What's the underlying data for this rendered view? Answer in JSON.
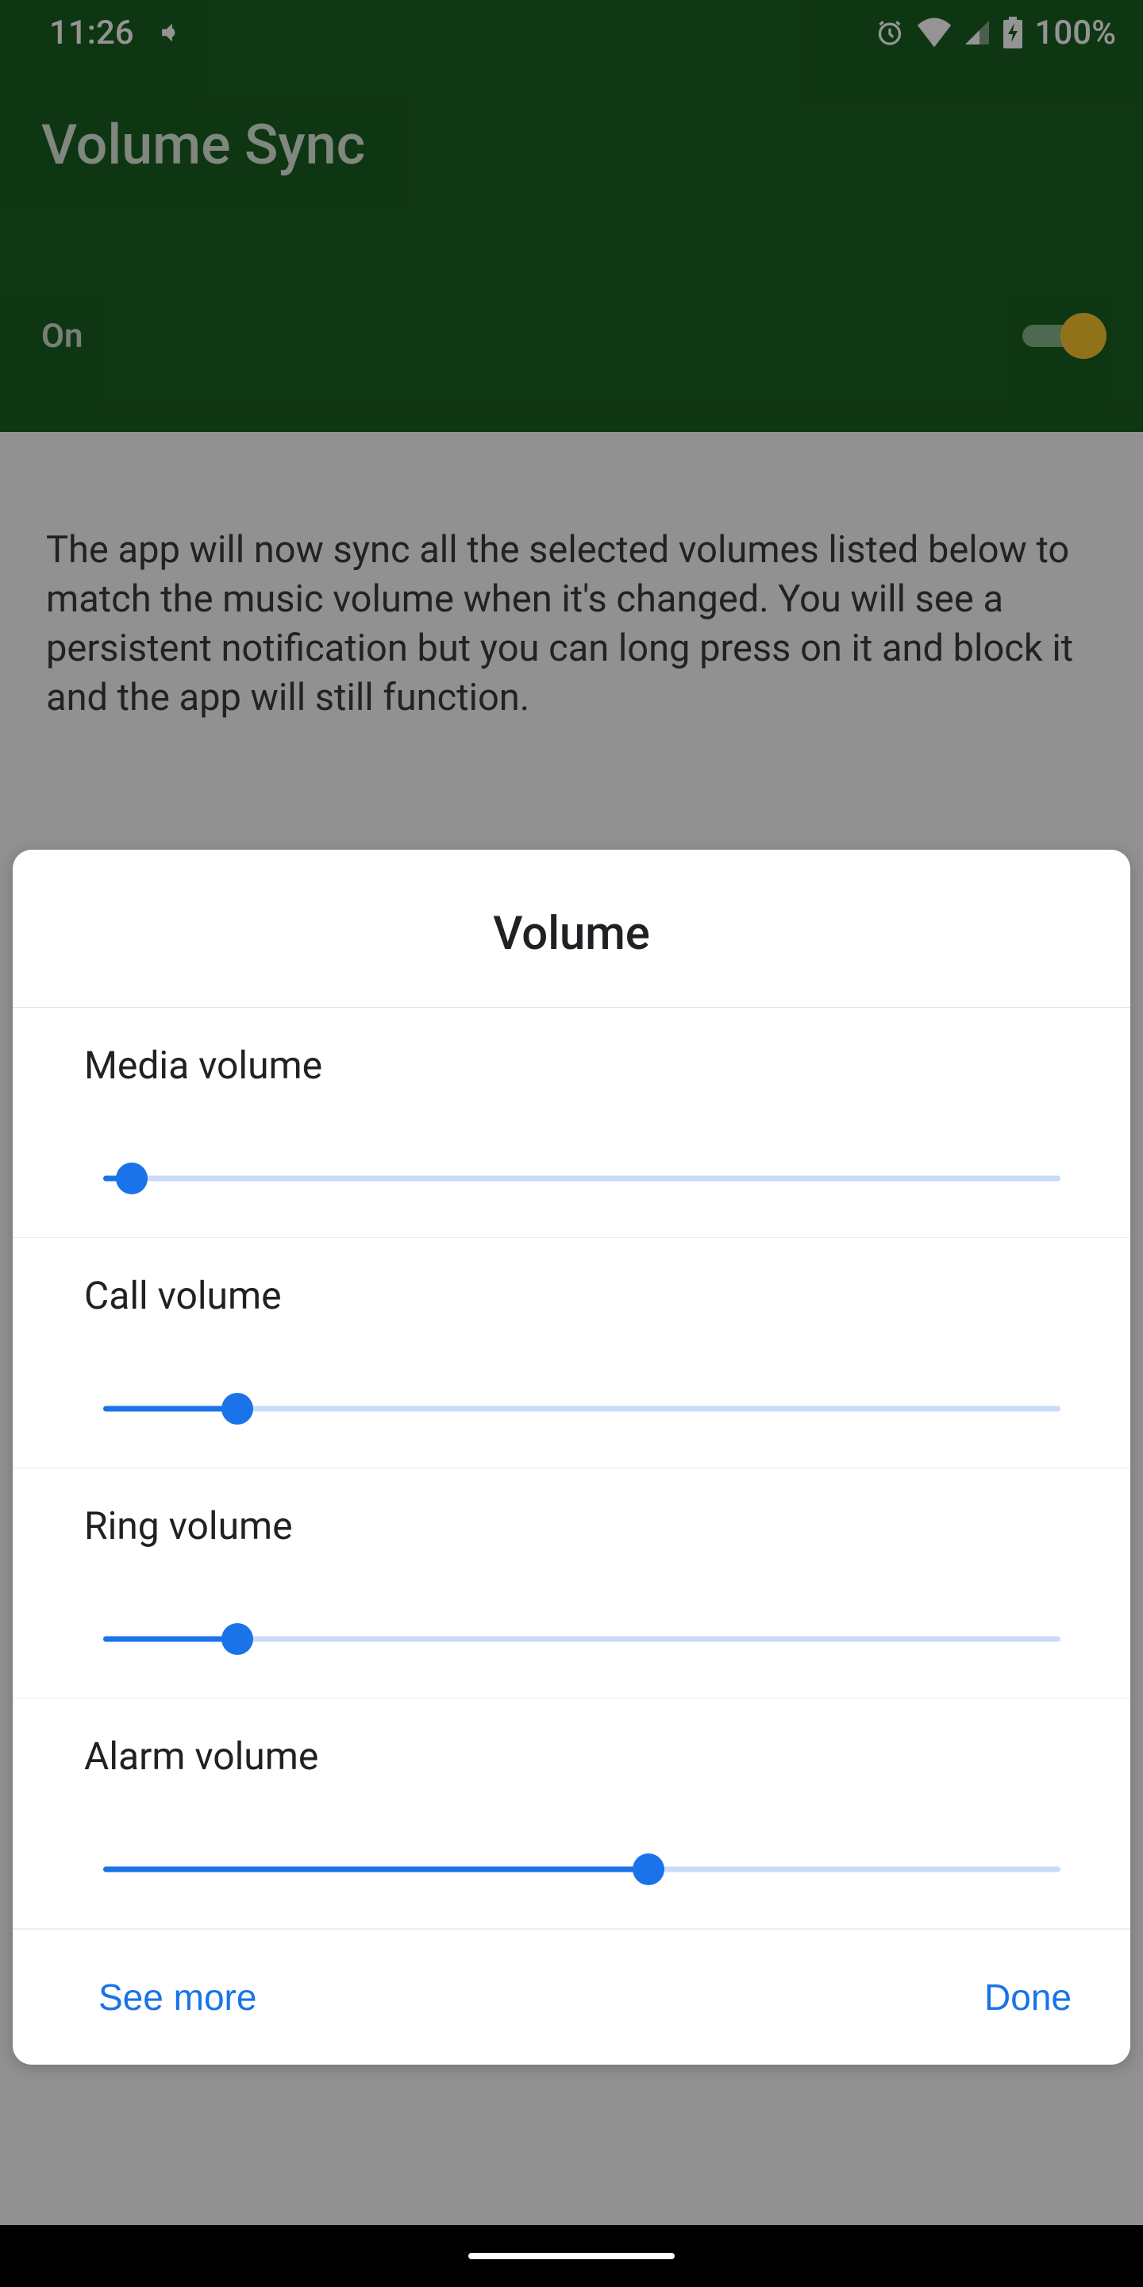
{
  "statusbar": {
    "time": "11:26",
    "battery_text": "100%"
  },
  "app": {
    "title": "Volume Sync",
    "on_label": "On",
    "on_state": true,
    "description": "The app will now sync all the selected volumes listed below to match the music volume when it's changed. You will see a persistent notification but you can long press on it and block it and the app will still function."
  },
  "dialog": {
    "title": "Volume",
    "sliders": [
      {
        "label": "Media volume",
        "value": 3
      },
      {
        "label": "Call volume",
        "value": 14
      },
      {
        "label": "Ring volume",
        "value": 14
      },
      {
        "label": "Alarm volume",
        "value": 57
      }
    ],
    "see_more": "See more",
    "done": "Done"
  }
}
